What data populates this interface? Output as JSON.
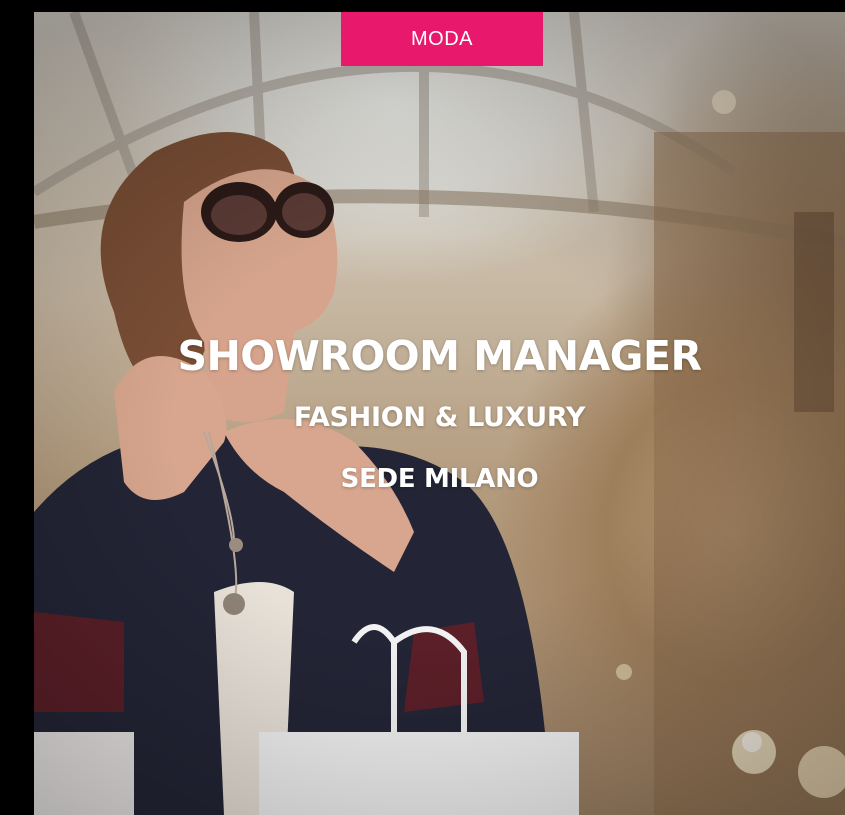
{
  "card": {
    "category": "MODA",
    "title": "SHOWROOM MANAGER",
    "subtitle": "FASHION & LUXURY",
    "location": "SEDE MILANO"
  },
  "colors": {
    "category_bg": "#e8186d",
    "text": "#ffffff"
  },
  "image": {
    "subject": "woman with sunglasses in shopping gallery holding bags"
  }
}
